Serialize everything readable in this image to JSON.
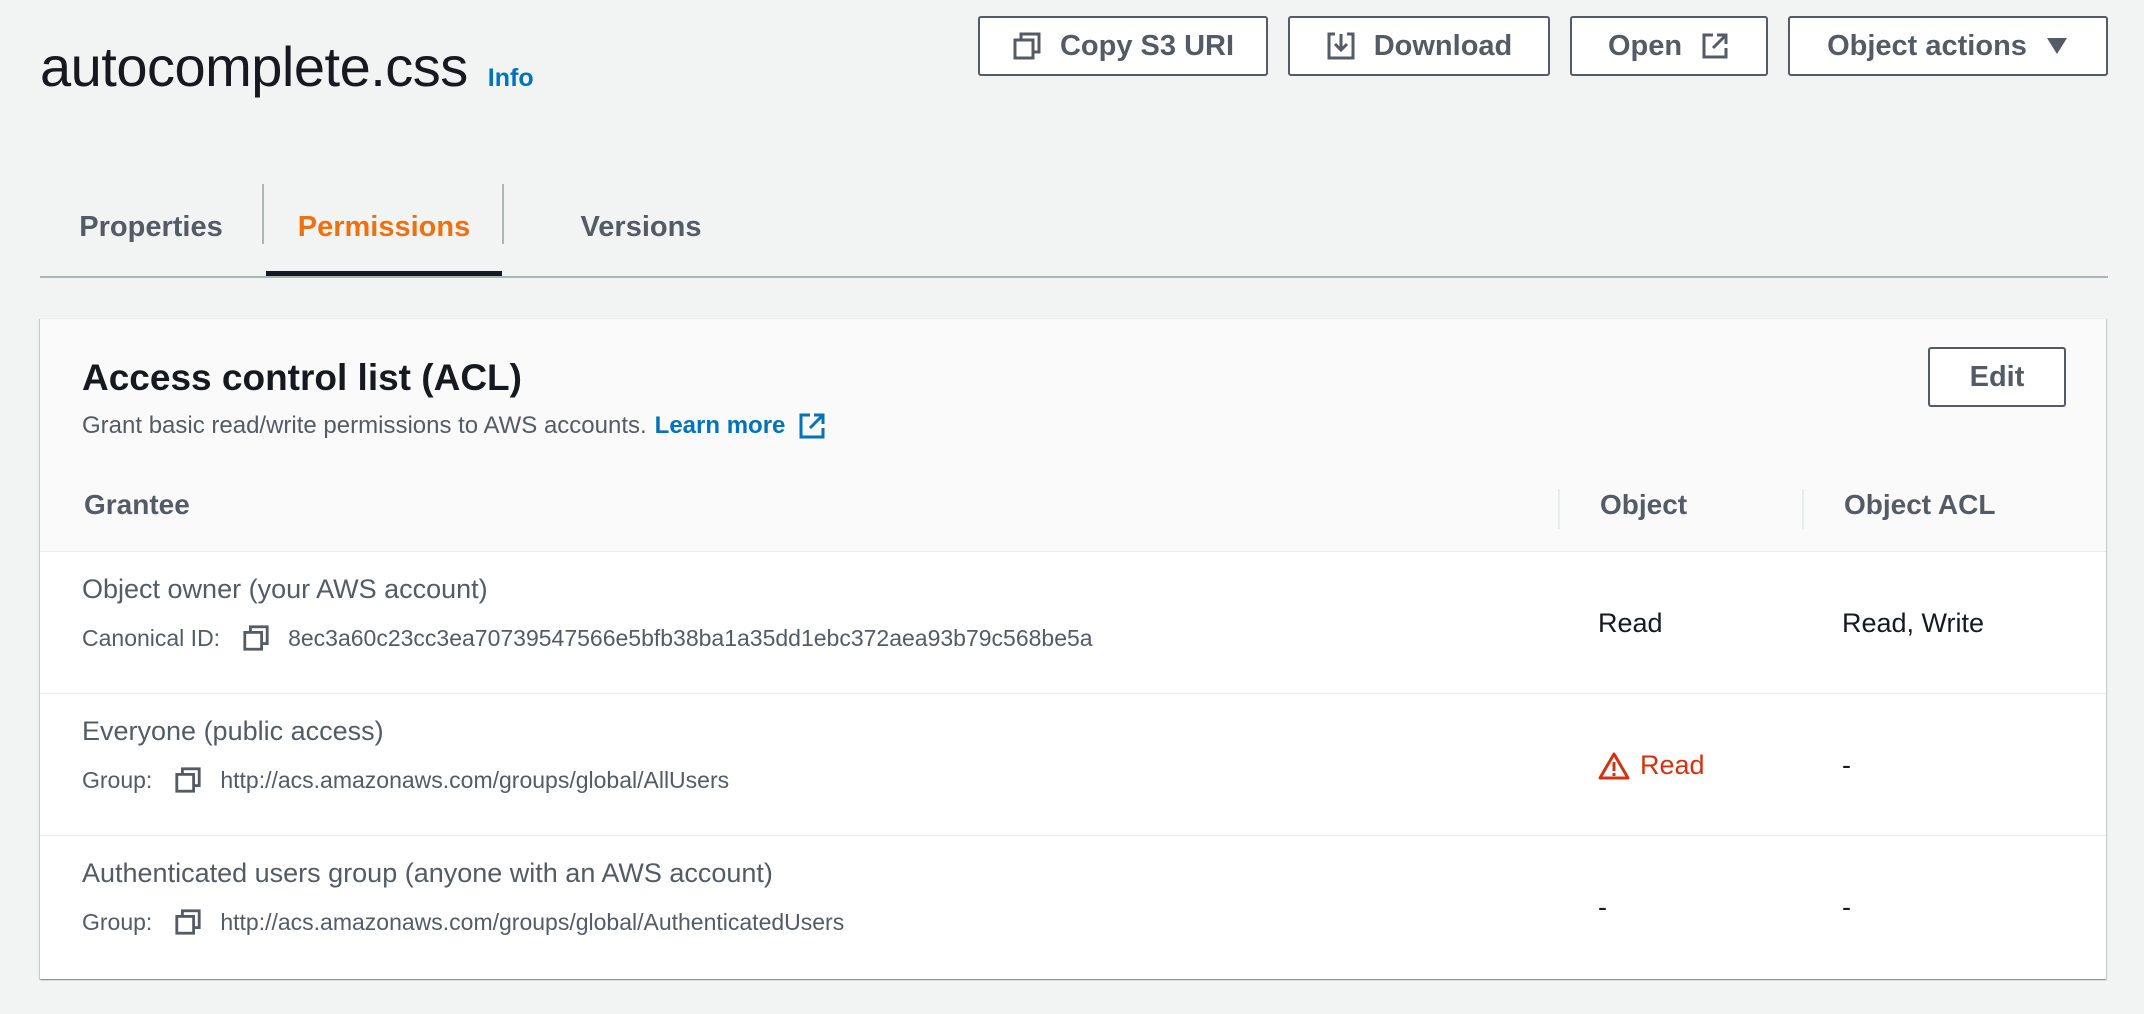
{
  "header": {
    "title": "autocomplete.css",
    "info_label": "Info",
    "buttons": {
      "copy_s3_uri": "Copy S3 URI",
      "download": "Download",
      "open": "Open",
      "object_actions": "Object actions"
    }
  },
  "tabs": [
    {
      "label": "Properties",
      "active": false
    },
    {
      "label": "Permissions",
      "active": true
    },
    {
      "label": "Versions",
      "active": false
    }
  ],
  "acl": {
    "title": "Access control list (ACL)",
    "description": "Grant basic read/write permissions to AWS accounts.",
    "learn_more": "Learn more",
    "edit_label": "Edit",
    "columns": [
      "Grantee",
      "Object",
      "Object ACL"
    ],
    "rows": [
      {
        "grantee": "Object owner (your AWS account)",
        "sub_label": "Canonical ID:",
        "sub_value": "8ec3a60c23cc3ea70739547566e5bfb38ba1a35dd1ebc372aea93b79c568be5a",
        "object": "Read",
        "object_warning": false,
        "object_acl": "Read, Write"
      },
      {
        "grantee": "Everyone (public access)",
        "sub_label": "Group:",
        "sub_value": "http://acs.amazonaws.com/groups/global/AllUsers",
        "object": "Read",
        "object_warning": true,
        "object_acl": "-"
      },
      {
        "grantee": "Authenticated users group (anyone with an AWS account)",
        "sub_label": "Group:",
        "sub_value": "http://acs.amazonaws.com/groups/global/AuthenticatedUsers",
        "object": "-",
        "object_warning": false,
        "object_acl": "-"
      }
    ]
  },
  "colors": {
    "link": "#0073bb",
    "active_tab": "#ec7211",
    "warning": "#d13212",
    "text_secondary": "#545b64"
  },
  "icons": [
    "copy-icon",
    "download-icon",
    "external-link-icon",
    "caret-down-icon",
    "warning-icon"
  ]
}
